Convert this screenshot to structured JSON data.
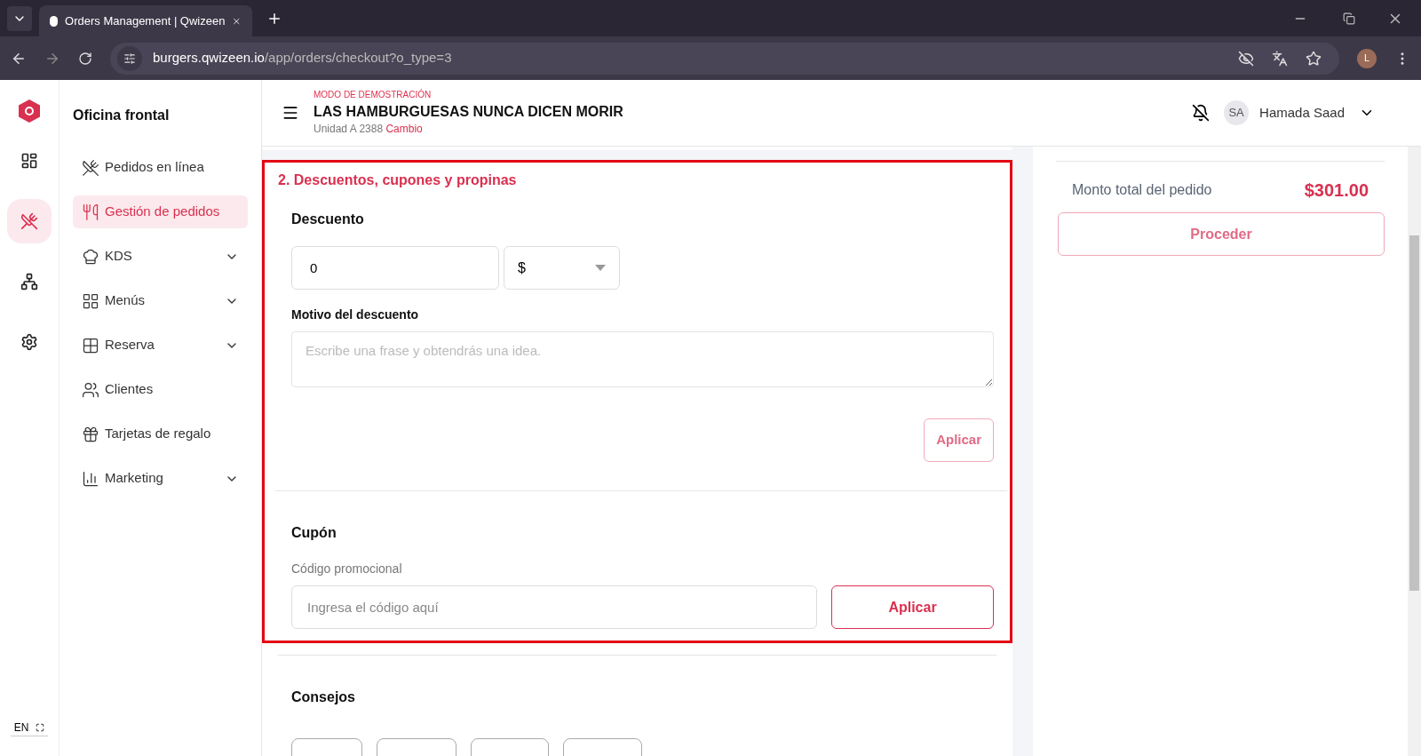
{
  "browser": {
    "tab_title": "Orders Management | Qwizeen",
    "url_host": "burgers.qwizeen.io",
    "url_path": "/app/orders/checkout?o_type=3",
    "profile_initial": "L"
  },
  "rail": [
    {
      "kind": "dashboard",
      "selected": false
    },
    {
      "kind": "orders",
      "selected": true
    },
    {
      "kind": "network",
      "selected": false
    },
    {
      "kind": "settings",
      "selected": false
    }
  ],
  "sidebar": {
    "title": "Oficina frontal",
    "items": [
      {
        "label": "Pedidos en línea",
        "selected": false,
        "has_children": false
      },
      {
        "label": "Gestión de pedidos",
        "selected": true,
        "has_children": false
      },
      {
        "label": "KDS",
        "selected": false,
        "has_children": true
      },
      {
        "label": "Menús",
        "selected": false,
        "has_children": true
      },
      {
        "label": "Reserva",
        "selected": false,
        "has_children": true
      },
      {
        "label": "Clientes",
        "selected": false,
        "has_children": false
      },
      {
        "label": "Tarjetas de regalo",
        "selected": false,
        "has_children": false
      },
      {
        "label": "Marketing",
        "selected": false,
        "has_children": true
      }
    ]
  },
  "language": "EN",
  "header": {
    "mode": "MODO DE DEMOSTRACIÓN",
    "restaurant": "LAS HAMBURGUESAS NUNCA DICEN MORIR",
    "unit": "Unidad A 2388",
    "change_link": "Cambio",
    "user_initials": "SA",
    "user_name": "Hamada Saad"
  },
  "section": {
    "title": "2. Descuentos, cupones y propinas",
    "discount": {
      "heading": "Descuento",
      "value": "0",
      "unit": "$",
      "reason_label": "Motivo del descuento",
      "reason_placeholder": "Escribe una frase y obtendrás una idea.",
      "apply": "Aplicar"
    },
    "coupon": {
      "heading": "Cupón",
      "label": "Código promocional",
      "placeholder": "Ingresa el código aquí",
      "apply": "Aplicar"
    },
    "tips": {
      "heading": "Consejos"
    }
  },
  "summary": {
    "label": "Monto total del pedido",
    "total": "$301.00",
    "proceed": "Proceder"
  }
}
